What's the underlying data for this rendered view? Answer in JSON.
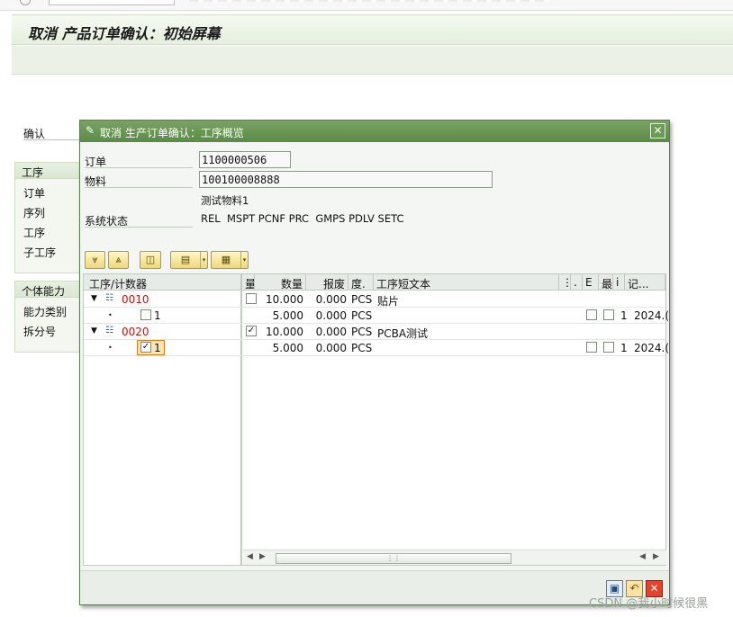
{
  "screen": {
    "title": "取消 产品订单确认：初始屏幕",
    "labels": {
      "confirm": "确认",
      "operation_group": "工序",
      "order": "订单",
      "sequence": "序列",
      "operation": "工序",
      "sub_operation": "子工序",
      "capacity_group": "个体能力",
      "capacity_category": "能力类别",
      "split_number": "拆分号"
    }
  },
  "dialog": {
    "title": "取消 生产订单确认：工序概览",
    "fields": {
      "order_label": "订单",
      "order_value": "1100000506",
      "material_label": "物料",
      "material_value": "100100008888",
      "material_desc": "测试物料1",
      "status_label": "系统状态",
      "status_value": "REL  MSPT PCNF PRC  GMPS PDLV SETC"
    },
    "toolbar": {
      "expand": "expand-all",
      "collapse": "collapse-all",
      "find": "find",
      "print": "print",
      "layout": "layout"
    },
    "table": {
      "columns": [
        "工序/计数器",
        "量",
        "数量",
        "报废",
        "度.",
        "工序短文本",
        "⋮",
        ".",
        "E",
        "最",
        "i",
        "记..."
      ],
      "rows": [
        {
          "node": "0010",
          "kind": "operation",
          "checked": false,
          "quantity": "10.000",
          "scrap": "0.000",
          "unit": "PCS",
          "text": "贴片",
          "c1": "",
          "c2": "",
          "i": "",
          "date": ""
        },
        {
          "node": "1",
          "kind": "counter",
          "checked": false,
          "quantity": "5.000",
          "scrap": "0.000",
          "unit": "PCS",
          "text": "",
          "c1": "☐",
          "c2": "☐",
          "i": "1",
          "date": "2024.("
        },
        {
          "node": "0020",
          "kind": "operation",
          "checked": true,
          "quantity": "10.000",
          "scrap": "0.000",
          "unit": "PCS",
          "text": "PCBA测试",
          "c1": "",
          "c2": "",
          "i": "",
          "date": ""
        },
        {
          "node": "1",
          "kind": "counter",
          "checked": true,
          "quantity": "5.000",
          "scrap": "0.000",
          "unit": "PCS",
          "text": "",
          "c1": "☐",
          "c2": "☐",
          "i": "1",
          "date": "2024.("
        }
      ]
    },
    "footer": {
      "save": "save",
      "undo": "undo",
      "close": "close"
    }
  },
  "watermark": "CSDN @我小时候很黑",
  "colors": {
    "title_bar": "#5b8a47",
    "screen_bg": "#ffffff",
    "operation_text": "#c0140f"
  }
}
